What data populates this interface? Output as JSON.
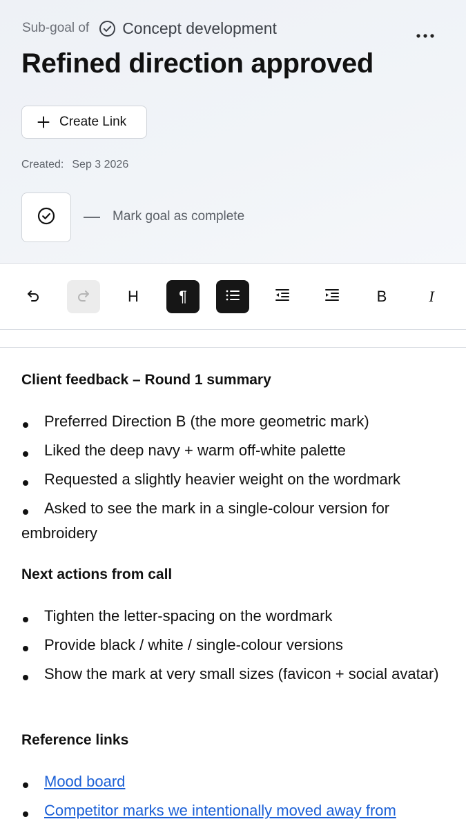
{
  "header": {
    "subgoal_prefix": "Sub-goal of",
    "subgoal_title": "Concept development",
    "more_icon": "more-horizontal-icon",
    "title": "Refined direction approved",
    "create_link_label": "Create Link",
    "created_label": "Created:",
    "created_date": "Sep 3 2026",
    "complete_label": "Mark goal as complete"
  },
  "toolbar": {
    "heading_label": "H",
    "bold_label": "B",
    "italic_label": "I",
    "paragraph_label": "¶",
    "active_color": "#161616",
    "items": [
      {
        "name": "undo",
        "icon": "undo-icon",
        "state": "enabled"
      },
      {
        "name": "redo",
        "icon": "redo-icon",
        "state": "disabled"
      },
      {
        "name": "heading",
        "icon": "heading-icon",
        "state": "enabled"
      },
      {
        "name": "paragraph",
        "icon": "pilcrow-icon",
        "state": "active"
      },
      {
        "name": "bullet-list",
        "icon": "list-icon",
        "state": "active"
      },
      {
        "name": "outdent",
        "icon": "outdent-icon",
        "state": "enabled"
      },
      {
        "name": "indent",
        "icon": "indent-icon",
        "state": "enabled"
      },
      {
        "name": "bold",
        "icon": "bold-icon",
        "state": "enabled"
      },
      {
        "name": "italic",
        "icon": "italic-icon",
        "state": "enabled"
      }
    ]
  },
  "content": {
    "section1": {
      "heading": "Client feedback – Round 1 summary",
      "items": [
        "Preferred Direction B (the more geometric mark)",
        "Liked the deep navy + warm off-white palette",
        "Requested a slightly heavier weight on the wordmark",
        "Asked to see the mark in a single-colour version for embroidery"
      ]
    },
    "section2": {
      "heading": "Next actions from call",
      "items": [
        "Tighten the letter-spacing on the wordmark",
        "Provide black / white / single-colour versions",
        "Show the mark at very small sizes (favicon + social avatar)"
      ]
    },
    "section3": {
      "heading": "Reference links",
      "links": [
        "Mood board",
        "Competitor marks we intentionally moved away from"
      ],
      "link_color": "#1a5fd6"
    }
  }
}
